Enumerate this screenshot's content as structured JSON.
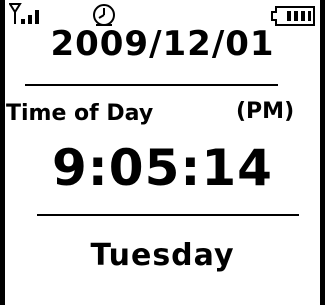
{
  "status_bar": {
    "signal_icon": "signal-antenna-icon",
    "alarm_icon": "alarm-clock-icon",
    "battery_icon": "battery-icon",
    "battery_level": 0.75
  },
  "clock": {
    "date": "2009/12/01",
    "label": "Time of Day",
    "ampm": "(PM)",
    "time": "9:05:14",
    "weekday": "Tuesday"
  }
}
